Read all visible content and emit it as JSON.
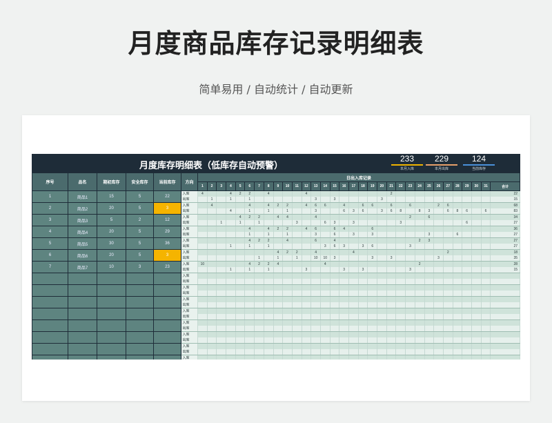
{
  "page": {
    "title": "月度商品库存记录明细表",
    "subtitle": "简单易用 / 自动统计 / 自动更新"
  },
  "sheet": {
    "title": "月度库存明细表（低库存自动预警）",
    "stats": [
      {
        "value": "233",
        "label": "本月入库",
        "color": "#f0b400"
      },
      {
        "value": "229",
        "label": "本月出库",
        "color": "#e8a06a"
      },
      {
        "value": "124",
        "label": "当前库存",
        "color": "#4a90d9"
      }
    ]
  },
  "left_table": {
    "headers": [
      "序号",
      "品名",
      "期初库存",
      "安全库存",
      "当前库存"
    ],
    "rows": [
      {
        "no": "1",
        "name": "商品1",
        "opening": "15",
        "safety": "5",
        "current": "22",
        "warn": false
      },
      {
        "no": "2",
        "name": "商品2",
        "opening": "20",
        "safety": "5",
        "current": "3",
        "warn": true
      },
      {
        "no": "3",
        "name": "商品3",
        "opening": "5",
        "safety": "2",
        "current": "12",
        "warn": false
      },
      {
        "no": "4",
        "name": "商品4",
        "opening": "20",
        "safety": "5",
        "current": "29",
        "warn": false
      },
      {
        "no": "5",
        "name": "商品5",
        "opening": "30",
        "safety": "5",
        "current": "36",
        "warn": false
      },
      {
        "no": "6",
        "name": "商品6",
        "opening": "20",
        "safety": "5",
        "current": "3",
        "warn": true
      },
      {
        "no": "7",
        "name": "商品7",
        "opening": "10",
        "safety": "3",
        "current": "23",
        "warn": false
      }
    ],
    "empty_rows": 8
  },
  "right_table": {
    "direction_header": "方向",
    "records_header": "日出入库记录",
    "total_header": "合计",
    "in_label": "入库",
    "out_label": "出库",
    "days": [
      "1",
      "2",
      "3",
      "4",
      "5",
      "6",
      "7",
      "8",
      "9",
      "10",
      "11",
      "12",
      "13",
      "14",
      "15",
      "16",
      "17",
      "18",
      "19",
      "20",
      "21",
      "22",
      "23",
      "24",
      "25",
      "26",
      "27",
      "28",
      "29",
      "30",
      "31"
    ],
    "rows": [
      {
        "dir": "in",
        "cells": {
          "1": "4",
          "4": "4",
          "5": "2",
          "6": "2",
          "8": "4",
          "12": "4",
          "21": "2"
        },
        "total": "22"
      },
      {
        "dir": "out",
        "cells": {
          "2": "1",
          "4": "1",
          "6": "1",
          "13": "3",
          "15": "3",
          "20": "3"
        },
        "total": "15"
      },
      {
        "dir": "in",
        "cells": {
          "2": "4",
          "6": "4",
          "8": "4",
          "9": "2",
          "10": "2",
          "12": "4",
          "13": "6",
          "14": "6",
          "16": "4",
          "18": "6",
          "19": "6",
          "21": "6",
          "23": "6",
          "26": "2",
          "27": "6"
        },
        "total": "68"
      },
      {
        "dir": "out",
        "cells": {
          "4": "4",
          "6": "1",
          "8": "1",
          "10": "1",
          "13": "3",
          "16": "6",
          "17": "3",
          "18": "6",
          "20": "3",
          "21": "6",
          "22": "8",
          "24": "8",
          "25": "3",
          "27": "6",
          "28": "8",
          "29": "6",
          "31": "6"
        },
        "total": "83"
      },
      {
        "dir": "in",
        "cells": {
          "5": "4",
          "6": "2",
          "7": "2",
          "9": "4",
          "10": "4",
          "13": "4",
          "23": "2",
          "25": "6"
        },
        "total": "34"
      },
      {
        "dir": "out",
        "cells": {
          "3": "1",
          "5": "1",
          "7": "1",
          "11": "3",
          "14": "6",
          "15": "3",
          "17": "3",
          "22": "3",
          "29": "6"
        },
        "total": "27"
      },
      {
        "dir": "in",
        "cells": {
          "6": "4",
          "8": "4",
          "9": "2",
          "10": "2",
          "12": "4",
          "13": "6",
          "15": "6",
          "16": "4",
          "19": "6"
        },
        "total": "36"
      },
      {
        "dir": "out",
        "cells": {
          "6": "1",
          "8": "1",
          "10": "1",
          "13": "3",
          "15": "6",
          "17": "3",
          "19": "3",
          "25": "3",
          "28": "6"
        },
        "total": "27"
      },
      {
        "dir": "in",
        "cells": {
          "6": "4",
          "7": "2",
          "8": "2",
          "10": "4",
          "13": "6",
          "15": "4",
          "24": "2",
          "25": "3"
        },
        "total": "27"
      },
      {
        "dir": "out",
        "cells": {
          "4": "1",
          "6": "1",
          "8": "1",
          "14": "3",
          "15": "6",
          "16": "3",
          "18": "3",
          "19": "6",
          "23": "3"
        },
        "total": "27"
      },
      {
        "dir": "in",
        "cells": {
          "9": "4",
          "10": "2",
          "11": "2",
          "13": "4",
          "17": "4",
          "27": "2"
        },
        "total": "18"
      },
      {
        "dir": "out",
        "cells": {
          "7": "1",
          "9": "1",
          "11": "1",
          "13": "10",
          "14": "10",
          "15": "3",
          "19": "3",
          "21": "3",
          "26": "3"
        },
        "total": "35"
      },
      {
        "dir": "in",
        "cells": {
          "1": "10",
          "6": "4",
          "7": "2",
          "8": "2",
          "9": "4",
          "14": "4",
          "24": "2"
        },
        "total": "28"
      },
      {
        "dir": "out",
        "cells": {
          "4": "1",
          "6": "1",
          "8": "1",
          "12": "3",
          "16": "3",
          "18": "3",
          "23": "3"
        },
        "total": "15"
      }
    ],
    "empty_pairs": 8
  }
}
